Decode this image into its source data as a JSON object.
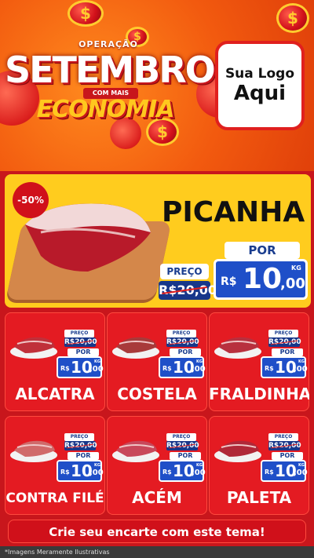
{
  "header": {
    "operacao": "OPERAÇÃO",
    "setembro": "SETEMBRO",
    "com_mais": "COM MAIS",
    "economia": "ECONOMIA",
    "logo_line1": "Sua Logo",
    "logo_line2": "Aqui"
  },
  "featured": {
    "discount": "-50%",
    "name": "PICANHA",
    "preco_label": "PREÇO",
    "old_price": "R$20,00",
    "por_label": "POR",
    "currency": "R$",
    "price_int": "10",
    "price_cents": ",00",
    "unit": "KG"
  },
  "products": [
    {
      "name": "ALCATRA",
      "preco_label": "PREÇO",
      "old_price": "R$20,00",
      "por_label": "POR",
      "currency": "R$",
      "price_int": "10",
      "price_cents": ",00",
      "unit": "KG"
    },
    {
      "name": "COSTELA",
      "preco_label": "PREÇO",
      "old_price": "R$20,00",
      "por_label": "POR",
      "currency": "R$",
      "price_int": "10",
      "price_cents": ",00",
      "unit": "KG"
    },
    {
      "name": "FRALDINHA",
      "preco_label": "PREÇO",
      "old_price": "R$20,00",
      "por_label": "POR",
      "currency": "R$",
      "price_int": "10",
      "price_cents": ",00",
      "unit": "KG"
    },
    {
      "name": "CONTRA FILÉ",
      "preco_label": "PREÇO",
      "old_price": "R$20,00",
      "por_label": "POR",
      "currency": "R$",
      "price_int": "10",
      "price_cents": ",00",
      "unit": "KG"
    },
    {
      "name": "ACÉM",
      "preco_label": "PREÇO",
      "old_price": "R$20,00",
      "por_label": "POR",
      "currency": "R$",
      "price_int": "10",
      "price_cents": ",00",
      "unit": "KG"
    },
    {
      "name": "PALETA",
      "preco_label": "PREÇO",
      "old_price": "R$20,00",
      "por_label": "POR",
      "currency": "R$",
      "price_int": "10",
      "price_cents": ",00",
      "unit": "KG"
    }
  ],
  "cta": "Crie seu encarte com este tema!",
  "footnote": "*Imagens Meramente Ilustrativas",
  "coin_symbol": "$",
  "colors": {
    "red": "#e41b22",
    "yellow": "#ffcc1e",
    "blue": "#1f4fc8",
    "orange": "#f25a0f"
  }
}
